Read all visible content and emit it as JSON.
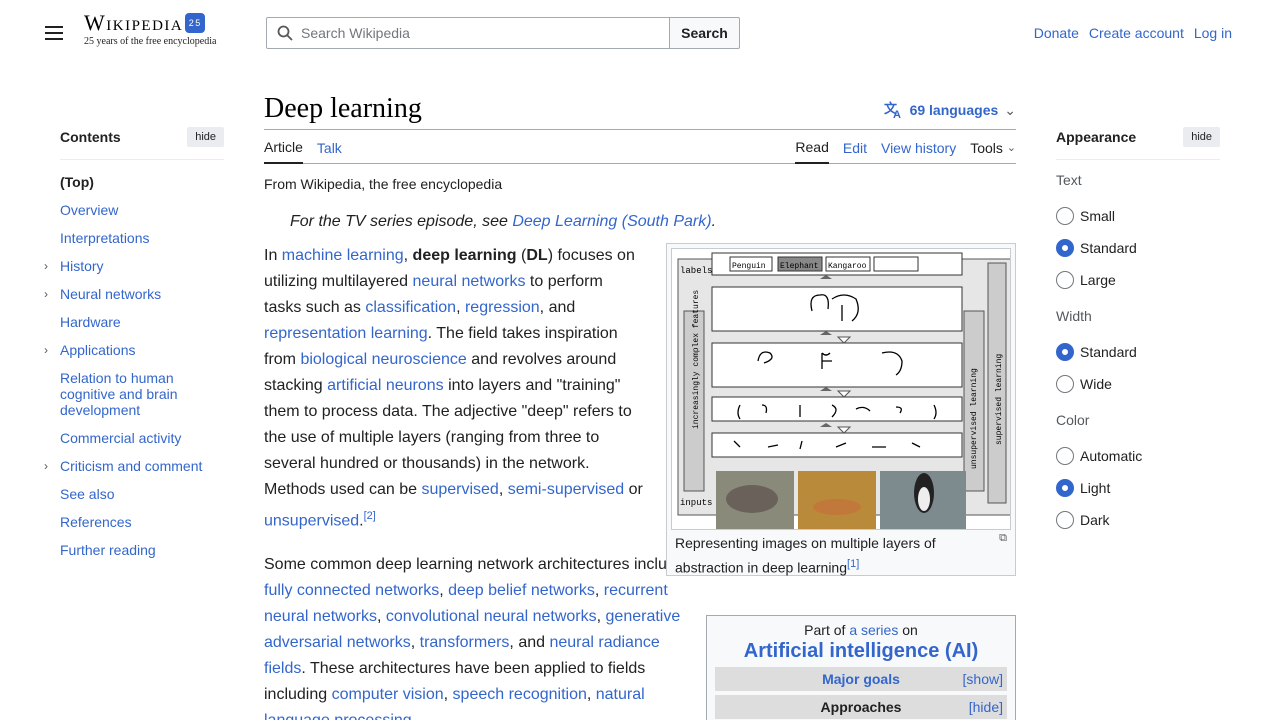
{
  "header": {
    "logo_text": "Wikipedia",
    "logo_badge": "25",
    "logo_tagline": "25 years of the free encyclopedia",
    "search_placeholder": "Search Wikipedia",
    "search_button": "Search",
    "user_links": [
      "Donate",
      "Create account",
      "Log in"
    ]
  },
  "toc": {
    "title": "Contents",
    "hide_label": "hide",
    "items": [
      {
        "label": "(Top)",
        "expandable": false
      },
      {
        "label": "Overview",
        "expandable": false
      },
      {
        "label": "Interpretations",
        "expandable": false
      },
      {
        "label": "History",
        "expandable": true
      },
      {
        "label": "Neural networks",
        "expandable": true
      },
      {
        "label": "Hardware",
        "expandable": false
      },
      {
        "label": "Applications",
        "expandable": true
      },
      {
        "label": "Relation to human cognitive and brain development",
        "expandable": false
      },
      {
        "label": "Commercial activity",
        "expandable": false
      },
      {
        "label": "Criticism and comment",
        "expandable": true
      },
      {
        "label": "See also",
        "expandable": false
      },
      {
        "label": "References",
        "expandable": false
      },
      {
        "label": "Further reading",
        "expandable": false
      }
    ]
  },
  "article": {
    "title": "Deep learning",
    "languages": "69 languages",
    "tabs_left": [
      "Article",
      "Talk"
    ],
    "tabs_right": [
      "Read",
      "Edit",
      "View history",
      "Tools"
    ],
    "from": "From Wikipedia, the free encyclopedia",
    "hatnote_prefix": "For the TV series episode, see ",
    "hatnote_link": "Deep Learning (South Park)",
    "hatnote_suffix": ".",
    "p1": {
      "t0": "In ",
      "l0": "machine learning",
      "t1": ", ",
      "b0": "deep learning",
      "t2": " (",
      "b1": "DL",
      "t3": ") focuses on utilizing multilayered ",
      "l1": "neural networks",
      "t4": " to perform tasks such as ",
      "l2": "classification",
      "t5": ", ",
      "l3": "regression",
      "t6": ", and ",
      "l4": "representation learning",
      "t7": ". The field takes inspiration from ",
      "l5": "biological neuroscience",
      "t8": " and revolves around stacking ",
      "l6": "artificial neurons",
      "t9": " into layers and \"training\" them to process data. The adjective \"deep\" refers to the use of multiple layers (ranging from three to several hundred or thousands) in the network. Methods used can be ",
      "l7": "supervised",
      "t10": ", ",
      "l8": "semi-supervised",
      "t11": " or ",
      "l9": "unsupervised",
      "t12": ".",
      "ref": "[2]"
    },
    "p2": {
      "t0": "Some common deep learning network architectures include ",
      "l0": "fully connected networks",
      "t1": ", ",
      "l1": "deep belief networks",
      "t2": ", ",
      "l2": "recurrent neural networks",
      "t3": ", ",
      "l3": "convolutional neural networks",
      "t4": ", ",
      "l4": "generative adversarial networks",
      "t5": ", ",
      "l5": "transformers",
      "t6": ", and ",
      "l6": "neural radiance fields",
      "t7": ". These architectures have been applied to fields including ",
      "l7": "computer vision",
      "t8": ", ",
      "l8": "speech recognition",
      "t9": ", ",
      "l9": "natural language processing",
      "t10": ","
    },
    "figure": {
      "caption": "Representing images on multiple layers of abstraction in deep learning",
      "ref": "[1]",
      "labels_tag": "labels",
      "inputs_tag": "inputs",
      "left_side": "increasingly complex features",
      "mid_side": "unsupervised learning",
      "right_side": "supervised learning",
      "class_labels": [
        "Penguin",
        "Elephant",
        "Kangaroo"
      ]
    },
    "infobox": {
      "part_prefix": "Part of ",
      "part_link": "a series",
      "part_suffix": " on",
      "title": "Artificial intelligence (AI)",
      "rows": [
        {
          "label": "Major goals",
          "toggle": "[show]"
        },
        {
          "label": "Approaches",
          "toggle": "[hide]"
        }
      ]
    }
  },
  "appearance": {
    "title": "Appearance",
    "hide_label": "hide",
    "groups": [
      {
        "label": "Text",
        "options": [
          {
            "label": "Small",
            "checked": false
          },
          {
            "label": "Standard",
            "checked": true
          },
          {
            "label": "Large",
            "checked": false
          }
        ]
      },
      {
        "label": "Width",
        "options": [
          {
            "label": "Standard",
            "checked": true
          },
          {
            "label": "Wide",
            "checked": false
          }
        ]
      },
      {
        "label": "Color",
        "options": [
          {
            "label": "Automatic",
            "checked": false
          },
          {
            "label": "Light",
            "checked": true
          },
          {
            "label": "Dark",
            "checked": false
          }
        ]
      }
    ]
  }
}
